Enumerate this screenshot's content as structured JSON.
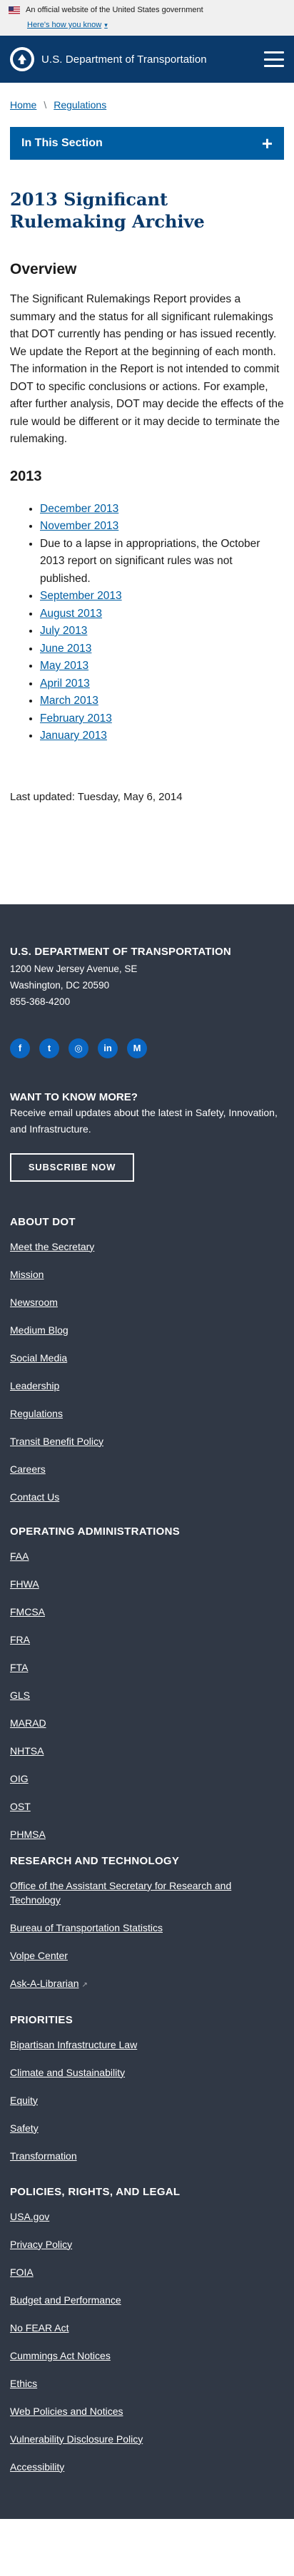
{
  "gov_banner": {
    "text": "An official website of the United States government",
    "link": "Here's how you know",
    "icon": "chevron-down-icon"
  },
  "header": {
    "agency": "U.S. Department of Transportation",
    "menu_icon": "hamburger-menu-icon"
  },
  "breadcrumb": [
    "Home",
    "Regulations"
  ],
  "in_section": {
    "label": "In This Section",
    "icon": "plus"
  },
  "main": {
    "title": "2013 Significant Rulemaking Archive",
    "overview_heading": "Overview",
    "overview_text": "The Significant Rulemakings Report provides a summary and the status for all significant rulemakings that DOT currently has pending or has issued recently. We update the Report at the beginning of each month. The information in the Report is not intended to commit DOT to specific conclusions or actions.  For example, after further analysis, DOT may decide the effects of the rule would be different or it may decide to terminate the rulemaking.",
    "year_heading": "2013",
    "months": [
      {
        "text": "December 2013",
        "link": true
      },
      {
        "text": "November 2013",
        "link": true
      },
      {
        "text": "Due to a lapse in appropriations, the October 2013 report on significant rules was not published.",
        "link": false
      },
      {
        "text": "September 2013",
        "link": true
      },
      {
        "text": "August 2013",
        "link": true
      },
      {
        "text": "July 2013",
        "link": true
      },
      {
        "text": "June 2013",
        "link": true
      },
      {
        "text": "May 2013",
        "link": true
      },
      {
        "text": "April 2013",
        "link": true
      },
      {
        "text": "March 2013",
        "link": true
      },
      {
        "text": "February 2013",
        "link": true
      },
      {
        "text": "January 2013",
        "link": true
      }
    ],
    "last_updated": "Last updated: Tuesday, May 6, 2014"
  },
  "footer": {
    "title": "U.S. DEPARTMENT OF TRANSPORTATION",
    "address_lines": [
      "1200 New Jersey Avenue, SE",
      "Washington, DC 20590",
      "855-368-4200"
    ],
    "socials": [
      {
        "name": "facebook-icon",
        "glyph": "f"
      },
      {
        "name": "twitter-icon",
        "glyph": "t"
      },
      {
        "name": "instagram-icon",
        "glyph": "◎"
      },
      {
        "name": "linkedin-icon",
        "glyph": "in"
      },
      {
        "name": "medium-icon",
        "glyph": "M"
      }
    ],
    "want_heading": "WANT TO KNOW MORE?",
    "want_text": "Receive email updates about the latest in Safety, Innovation, and Infrastructure.",
    "subscribe": "SUBSCRIBE NOW",
    "sections": [
      {
        "heading": "ABOUT DOT",
        "links": [
          "Meet the Secretary",
          "Mission",
          "Newsroom",
          "Medium Blog",
          "Social Media",
          "Leadership",
          "Regulations",
          "Transit Benefit Policy",
          "Careers",
          "Contact Us"
        ]
      },
      {
        "heading": "OPERATING ADMINISTRATIONS",
        "links": [
          "FAA",
          "FHWA",
          "FMCSA",
          "FRA",
          "FTA",
          "GLS",
          "MARAD",
          "NHTSA",
          "OIG",
          "OST",
          "PHMSA"
        ]
      },
      {
        "heading": "RESEARCH AND TECHNOLOGY",
        "links": [
          "Office of the Assistant Secretary for Research and Technology",
          "Bureau of Transportation Statistics",
          "Volpe Center",
          "Ask-A-Librarian"
        ]
      },
      {
        "heading": "PRIORITIES",
        "links": [
          "Bipartisan Infrastructure Law",
          "Climate and Sustainability",
          "Equity",
          "Safety",
          "Transformation"
        ]
      },
      {
        "heading": "POLICIES, RIGHTS, AND LEGAL",
        "links": [
          "USA.gov",
          "Privacy Policy",
          "FOIA",
          "Budget and Performance",
          "No FEAR Act",
          "Cummings Act Notices",
          "Ethics",
          "Web Policies and Notices",
          "Vulnerability Disclosure Policy",
          "Accessibility"
        ]
      }
    ],
    "external_link_icon": "external-link-icon"
  }
}
